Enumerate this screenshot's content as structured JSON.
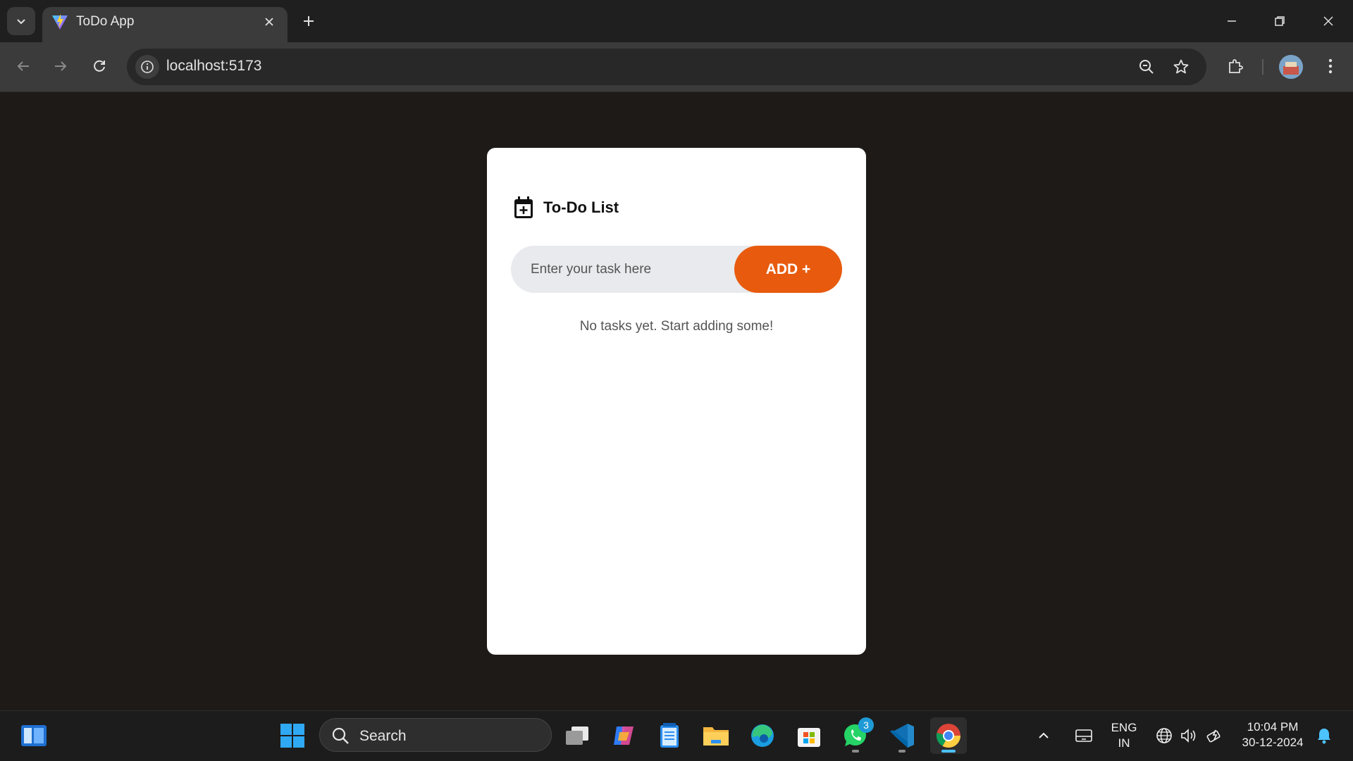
{
  "browser": {
    "tab_title": "ToDo App",
    "url": "localhost:5173"
  },
  "app": {
    "title": "To-Do List",
    "input_placeholder": "Enter your task here",
    "add_button_label": "ADD +",
    "empty_message": "No tasks yet. Start adding some!",
    "accent_color": "#e85b0e"
  },
  "taskbar": {
    "search_label": "Search",
    "language": "ENG",
    "region": "IN",
    "time": "10:04 PM",
    "date": "30-12-2024",
    "whatsapp_badge": "3",
    "apps": [
      "start",
      "task-view",
      "copilot",
      "notepad",
      "file-explorer",
      "edge",
      "microsoft-store",
      "whatsapp",
      "vscode",
      "chrome"
    ]
  }
}
